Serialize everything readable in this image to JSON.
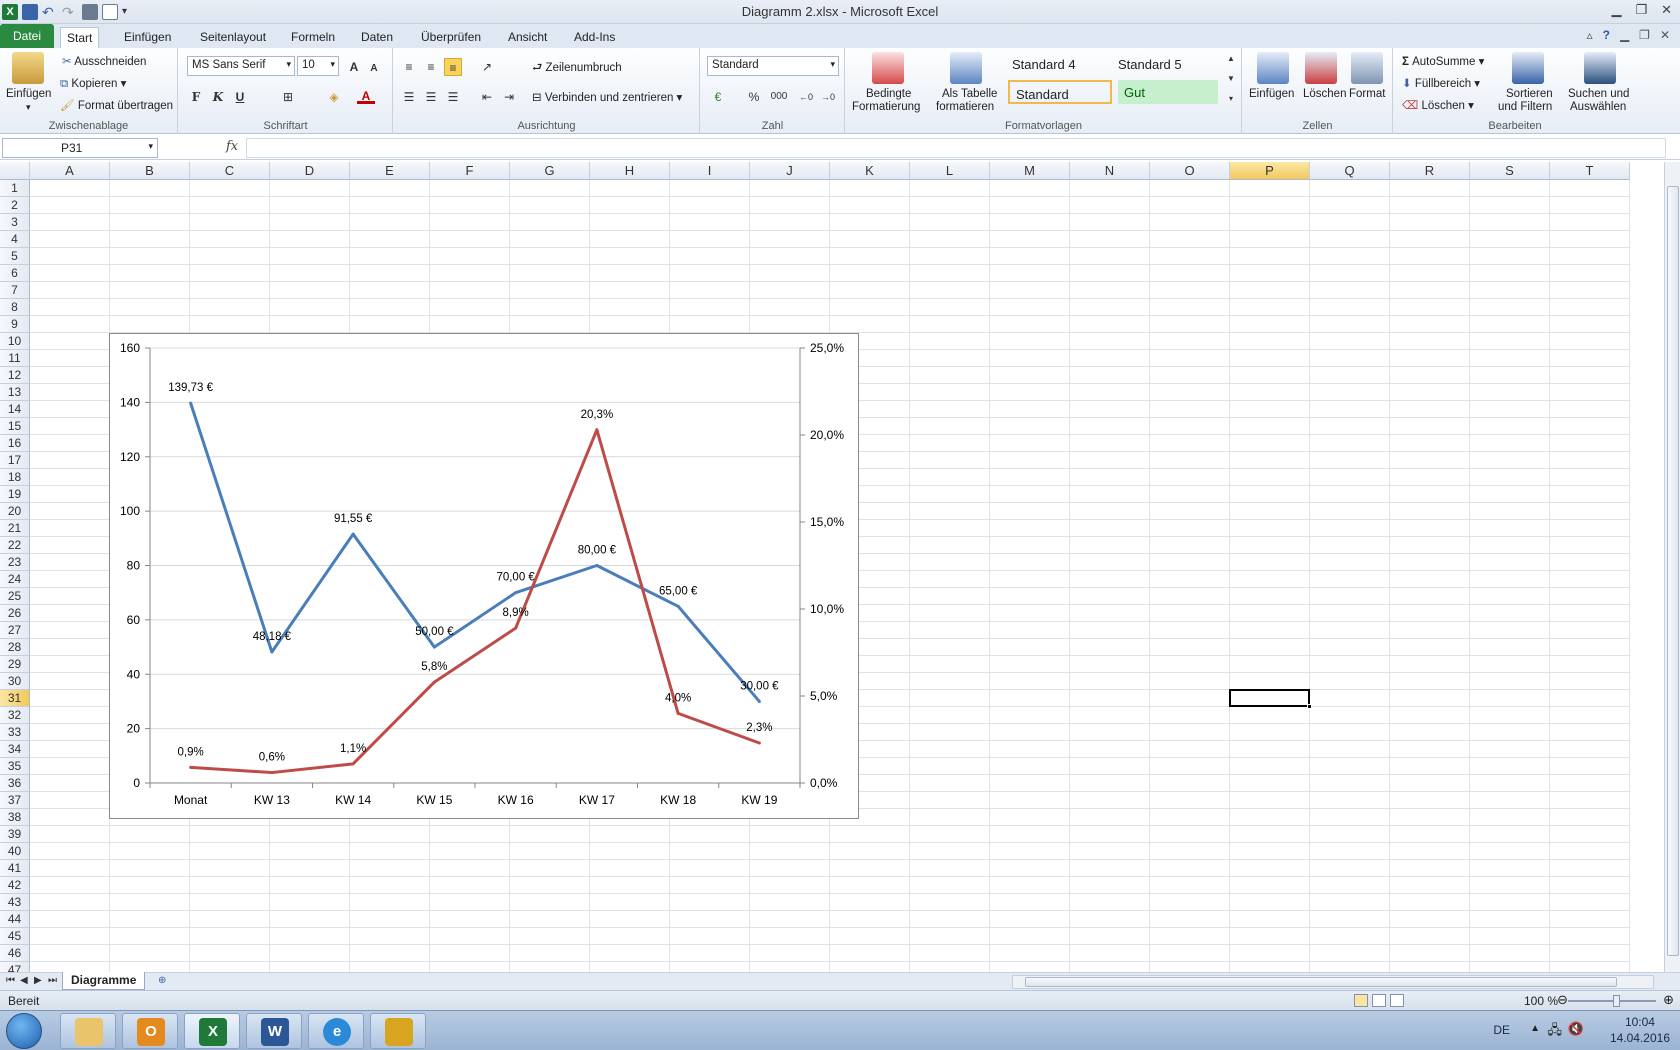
{
  "window": {
    "title": "Diagramm 2.xlsx  -  Microsoft Excel"
  },
  "tabs": [
    {
      "label": "Datei"
    },
    {
      "label": "Start"
    },
    {
      "label": "Einfügen"
    },
    {
      "label": "Seitenlayout"
    },
    {
      "label": "Formeln"
    },
    {
      "label": "Daten"
    },
    {
      "label": "Überprüfen"
    },
    {
      "label": "Ansicht"
    },
    {
      "label": "Add-Ins"
    }
  ],
  "ribbon": {
    "clipboard": {
      "paste": "Einfügen",
      "cut": "Ausschneiden",
      "copy": "Kopieren",
      "format_painter": "Format übertragen",
      "group": "Zwischenablage"
    },
    "font": {
      "name": "MS Sans Serif",
      "size": "10",
      "bold": "F",
      "italic": "K",
      "underline": "U",
      "group": "Schriftart"
    },
    "alignment": {
      "wrap": "Zeilenumbruch",
      "merge": "Verbinden und zentrieren",
      "group": "Ausrichtung"
    },
    "number": {
      "format": "Standard",
      "percent": "%",
      "thousands": "000",
      "group": "Zahl"
    },
    "styles": {
      "conditional_1": "Bedingte",
      "conditional_2": "Formatierung",
      "table_1": "Als Tabelle",
      "table_2": "formatieren",
      "s4": "Standard 4",
      "s5": "Standard 5",
      "standard": "Standard",
      "gut": "Gut",
      "group": "Formatvorlagen"
    },
    "cells": {
      "insert": "Einfügen",
      "delete": "Löschen",
      "format": "Format",
      "group": "Zellen"
    },
    "editing": {
      "autosum": "AutoSumme",
      "fill": "Füllbereich",
      "clear": "Löschen",
      "sort_1": "Sortieren",
      "sort_2": "und Filtern",
      "find_1": "Suchen und",
      "find_2": "Auswählen",
      "group": "Bearbeiten"
    }
  },
  "formula_bar": {
    "name_box": "P31",
    "fx": "fx",
    "value": ""
  },
  "grid": {
    "columns": [
      "A",
      "B",
      "C",
      "D",
      "E",
      "F",
      "G",
      "H",
      "I",
      "J",
      "K",
      "L",
      "M",
      "N",
      "O",
      "P",
      "Q",
      "R",
      "S",
      "T"
    ],
    "selected_column": "P",
    "selected_row": 31,
    "row_count": 47
  },
  "chart_data": {
    "type": "line",
    "categories": [
      "Monat",
      "KW 13",
      "KW 14",
      "KW 15",
      "KW 16",
      "KW 17",
      "KW 18",
      "KW 19"
    ],
    "series": [
      {
        "axis": "left",
        "color": "#4a7ebb",
        "values": [
          139.73,
          48.18,
          91.55,
          50.0,
          70.0,
          80.0,
          65.0,
          30.0
        ],
        "labels": [
          "139,73 €",
          "48,18 €",
          "91,55 €",
          "50,00 €",
          "70,00 €",
          "80,00 €",
          "65,00 €",
          "30,00 €"
        ]
      },
      {
        "axis": "right",
        "color": "#be4b48",
        "values": [
          0.9,
          0.6,
          1.1,
          5.8,
          8.9,
          20.3,
          4.0,
          2.3
        ],
        "labels": [
          "0,9%",
          "0,6%",
          "1,1%",
          "5,8%",
          "8,9%",
          "20,3%",
          "4,0%",
          "2,3%"
        ]
      }
    ],
    "y_left": {
      "min": 0,
      "max": 160,
      "ticks": [
        "0",
        "20",
        "40",
        "60",
        "80",
        "100",
        "120",
        "140",
        "160"
      ]
    },
    "y_right": {
      "min": 0,
      "max": 25,
      "ticks": [
        "0,0%",
        "5,0%",
        "10,0%",
        "15,0%",
        "20,0%",
        "25,0%"
      ]
    },
    "grid": true,
    "legend": "none"
  },
  "sheets": {
    "active": "Diagramme"
  },
  "status": {
    "ready": "Bereit",
    "zoom": "100 %"
  },
  "taskbar": {
    "lang": "DE",
    "time": "10:04",
    "date": "14.04.2016",
    "apps": [
      "explorer",
      "outlook",
      "excel",
      "word",
      "internet-explorer",
      "other"
    ]
  }
}
